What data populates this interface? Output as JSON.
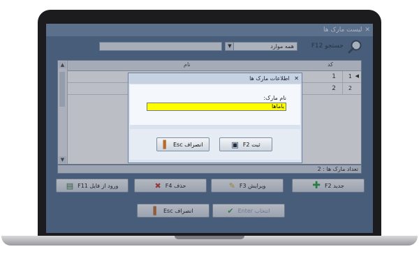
{
  "window": {
    "title": "لیست مارک ها",
    "close": "✕"
  },
  "search": {
    "label": "جستجو F12",
    "filter_value": "همه موارد",
    "filter_arrow": "▼",
    "query": ""
  },
  "grid": {
    "headers": {
      "code": "کد",
      "name": "نام"
    },
    "rows": [
      {
        "num": "1",
        "code": "1",
        "marker": "◀",
        "name": ""
      },
      {
        "num": "2",
        "code": "2",
        "marker": "",
        "name": ""
      }
    ]
  },
  "status": {
    "count_text": "تعداد مارک ها : 2"
  },
  "buttons": {
    "new": "جدید F2",
    "edit": "ویرایش F3",
    "delete": "حذف F4",
    "import": "ورود از فایل F11",
    "cancel": "انصراف Esc",
    "select": "انتخاب Enter"
  },
  "dialog": {
    "title": "اطلاعات مارک ها",
    "field_label": "نام مارک:",
    "field_value": "باماها",
    "save": "ثبت F2",
    "cancel": "انصراف Esc"
  },
  "colors": {
    "field_highlight": "#ffff00",
    "screen_bg": "#4d6a8c",
    "add_icon": "#1e9a3a",
    "delete_icon": "#c0392b"
  }
}
